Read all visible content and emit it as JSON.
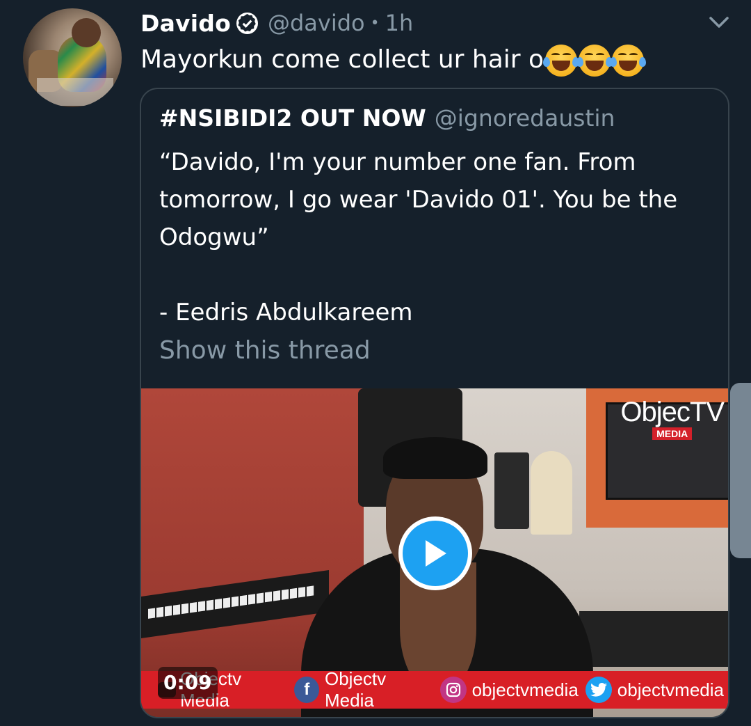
{
  "tweet": {
    "author_name": "Davido",
    "author_handle": "@davido",
    "separator": "•",
    "time_ago": "1h",
    "text": "Mayorkun come collect ur hair o",
    "emoji_name": "face-with-tears-of-joy",
    "emoji_count": 3
  },
  "quoted_tweet": {
    "author_name": "#NSIBIDI2 OUT NOW",
    "author_handle": "@ignoredaustin",
    "body": "“Davido, I'm your number one fan. From tomorrow, I go wear 'Davido 01'. You be the Odogwu”\n\n- Eedris Abdulkareem",
    "show_thread_label": "Show this thread"
  },
  "video": {
    "duration": "0:09",
    "logo_text": "ObjecTV",
    "logo_badge": "MEDIA",
    "banner": {
      "youtube": "Objectv Media",
      "facebook": "Objectv Media",
      "instagram": "objectvmedia",
      "twitter": "objectvmedia"
    }
  },
  "colors": {
    "background": "#15202b",
    "secondary_text": "#8899a6",
    "accent": "#1da1f2",
    "border": "#38444d",
    "banner_red": "#d81f26"
  }
}
